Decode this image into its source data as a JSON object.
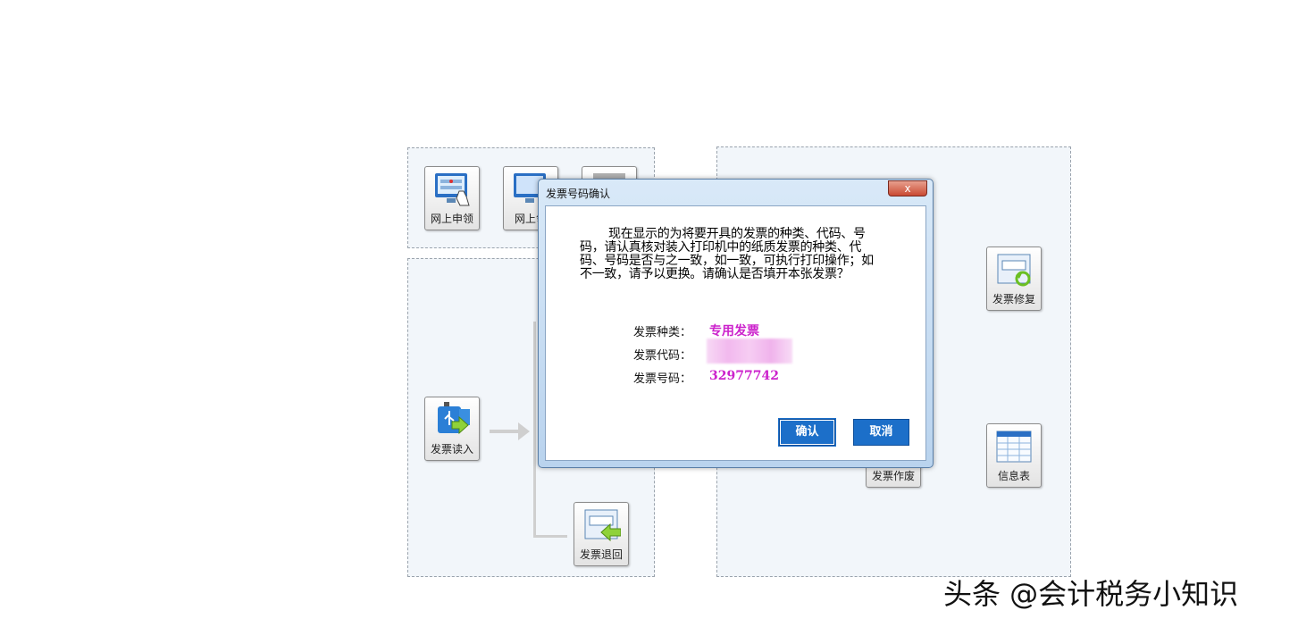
{
  "tiles": {
    "online_apply": "网上申领",
    "online_claim": "网上领",
    "invoice_read": "发票读入",
    "invoice_return": "发票退回",
    "invoice_repair": "发票修复",
    "invoice_void": "发票作废",
    "info_table": "信息表"
  },
  "dialog": {
    "title": "发票号码确认",
    "close_label": "x",
    "message": "现在显示的为将要开具的发票的种类、代码、号码，请认真核对装入打印机中的纸质发票的种类、代码、号码是否与之一致，如一致，可执行打印操作；如不一致，请予以更换。请确认是否填开本张发票？",
    "type_label": "发票种类：",
    "type_value": "专用发票",
    "code_label": "发票代码：",
    "number_label": "发票号码：",
    "number_value": "32977742",
    "confirm": "确认",
    "cancel": "取消"
  },
  "colors": {
    "value": "#cc22cc",
    "button": "#1c6fc9"
  },
  "watermark": "头条 @会计税务小知识"
}
